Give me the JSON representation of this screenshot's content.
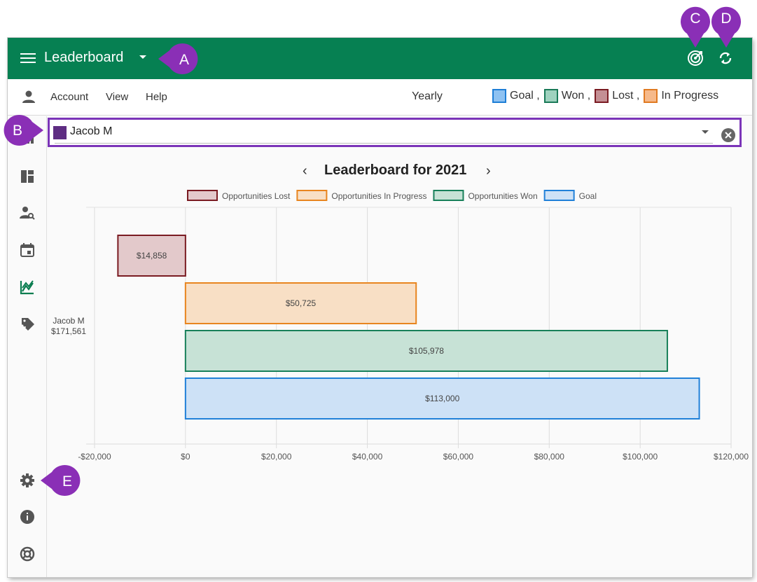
{
  "app": {
    "title": "Leaderboard"
  },
  "menu": {
    "items": [
      "Account",
      "View",
      "Help"
    ],
    "period": "Yearly"
  },
  "top_legend": [
    {
      "label": "Goal ,",
      "fill": "#8ec2f2",
      "stroke": "#1e7ed6"
    },
    {
      "label": "Won ,",
      "fill": "#9fd2bf",
      "stroke": "#1a7a58"
    },
    {
      "label": "Lost ,",
      "fill": "#c48f94",
      "stroke": "#7a1b22"
    },
    {
      "label": "In Progress",
      "fill": "#f6b98a",
      "stroke": "#e07a22"
    }
  ],
  "selector": {
    "value": "Jacob M",
    "swatch": "#5e2d82"
  },
  "chart_title": "Leaderboard for 2021",
  "callouts": [
    "A",
    "B",
    "C",
    "D",
    "E"
  ],
  "sidebar_icons": [
    "dashboard-icon",
    "board-icon",
    "person-search-icon",
    "calendar-icon",
    "chart-icon",
    "tag-transfer-icon",
    "settings-icon",
    "info-icon",
    "help-lifebuoy-icon"
  ],
  "chart_data": {
    "type": "bar",
    "orientation": "horizontal",
    "title": "Leaderboard for 2021",
    "category": {
      "name": "Jacob M",
      "total": "$171,561"
    },
    "series": [
      {
        "name": "Opportunities Lost",
        "value": -14858,
        "label": "$14,858",
        "fill": "#e3c9cb",
        "stroke": "#7a1b22"
      },
      {
        "name": "Opportunities In Progress",
        "value": 50725,
        "label": "$50,725",
        "fill": "#f8dfc5",
        "stroke": "#e8851f"
      },
      {
        "name": "Opportunities Won",
        "value": 105978,
        "label": "$105,978",
        "fill": "#c7e2d6",
        "stroke": "#18805a"
      },
      {
        "name": "Goal",
        "value": 113000,
        "label": "$113,000",
        "fill": "#cde1f6",
        "stroke": "#2080d8"
      }
    ],
    "legend_order": [
      "Opportunities Lost",
      "Opportunities In Progress",
      "Opportunities Won",
      "Goal"
    ],
    "xlim": [
      -20000,
      120000
    ],
    "xticks": [
      -20000,
      0,
      20000,
      40000,
      60000,
      80000,
      100000,
      120000
    ],
    "xtick_labels": [
      "-$20,000",
      "$0",
      "$20,000",
      "$40,000",
      "$60,000",
      "$80,000",
      "$100,000",
      "$120,000"
    ],
    "grid": true,
    "legend_position": "top"
  }
}
